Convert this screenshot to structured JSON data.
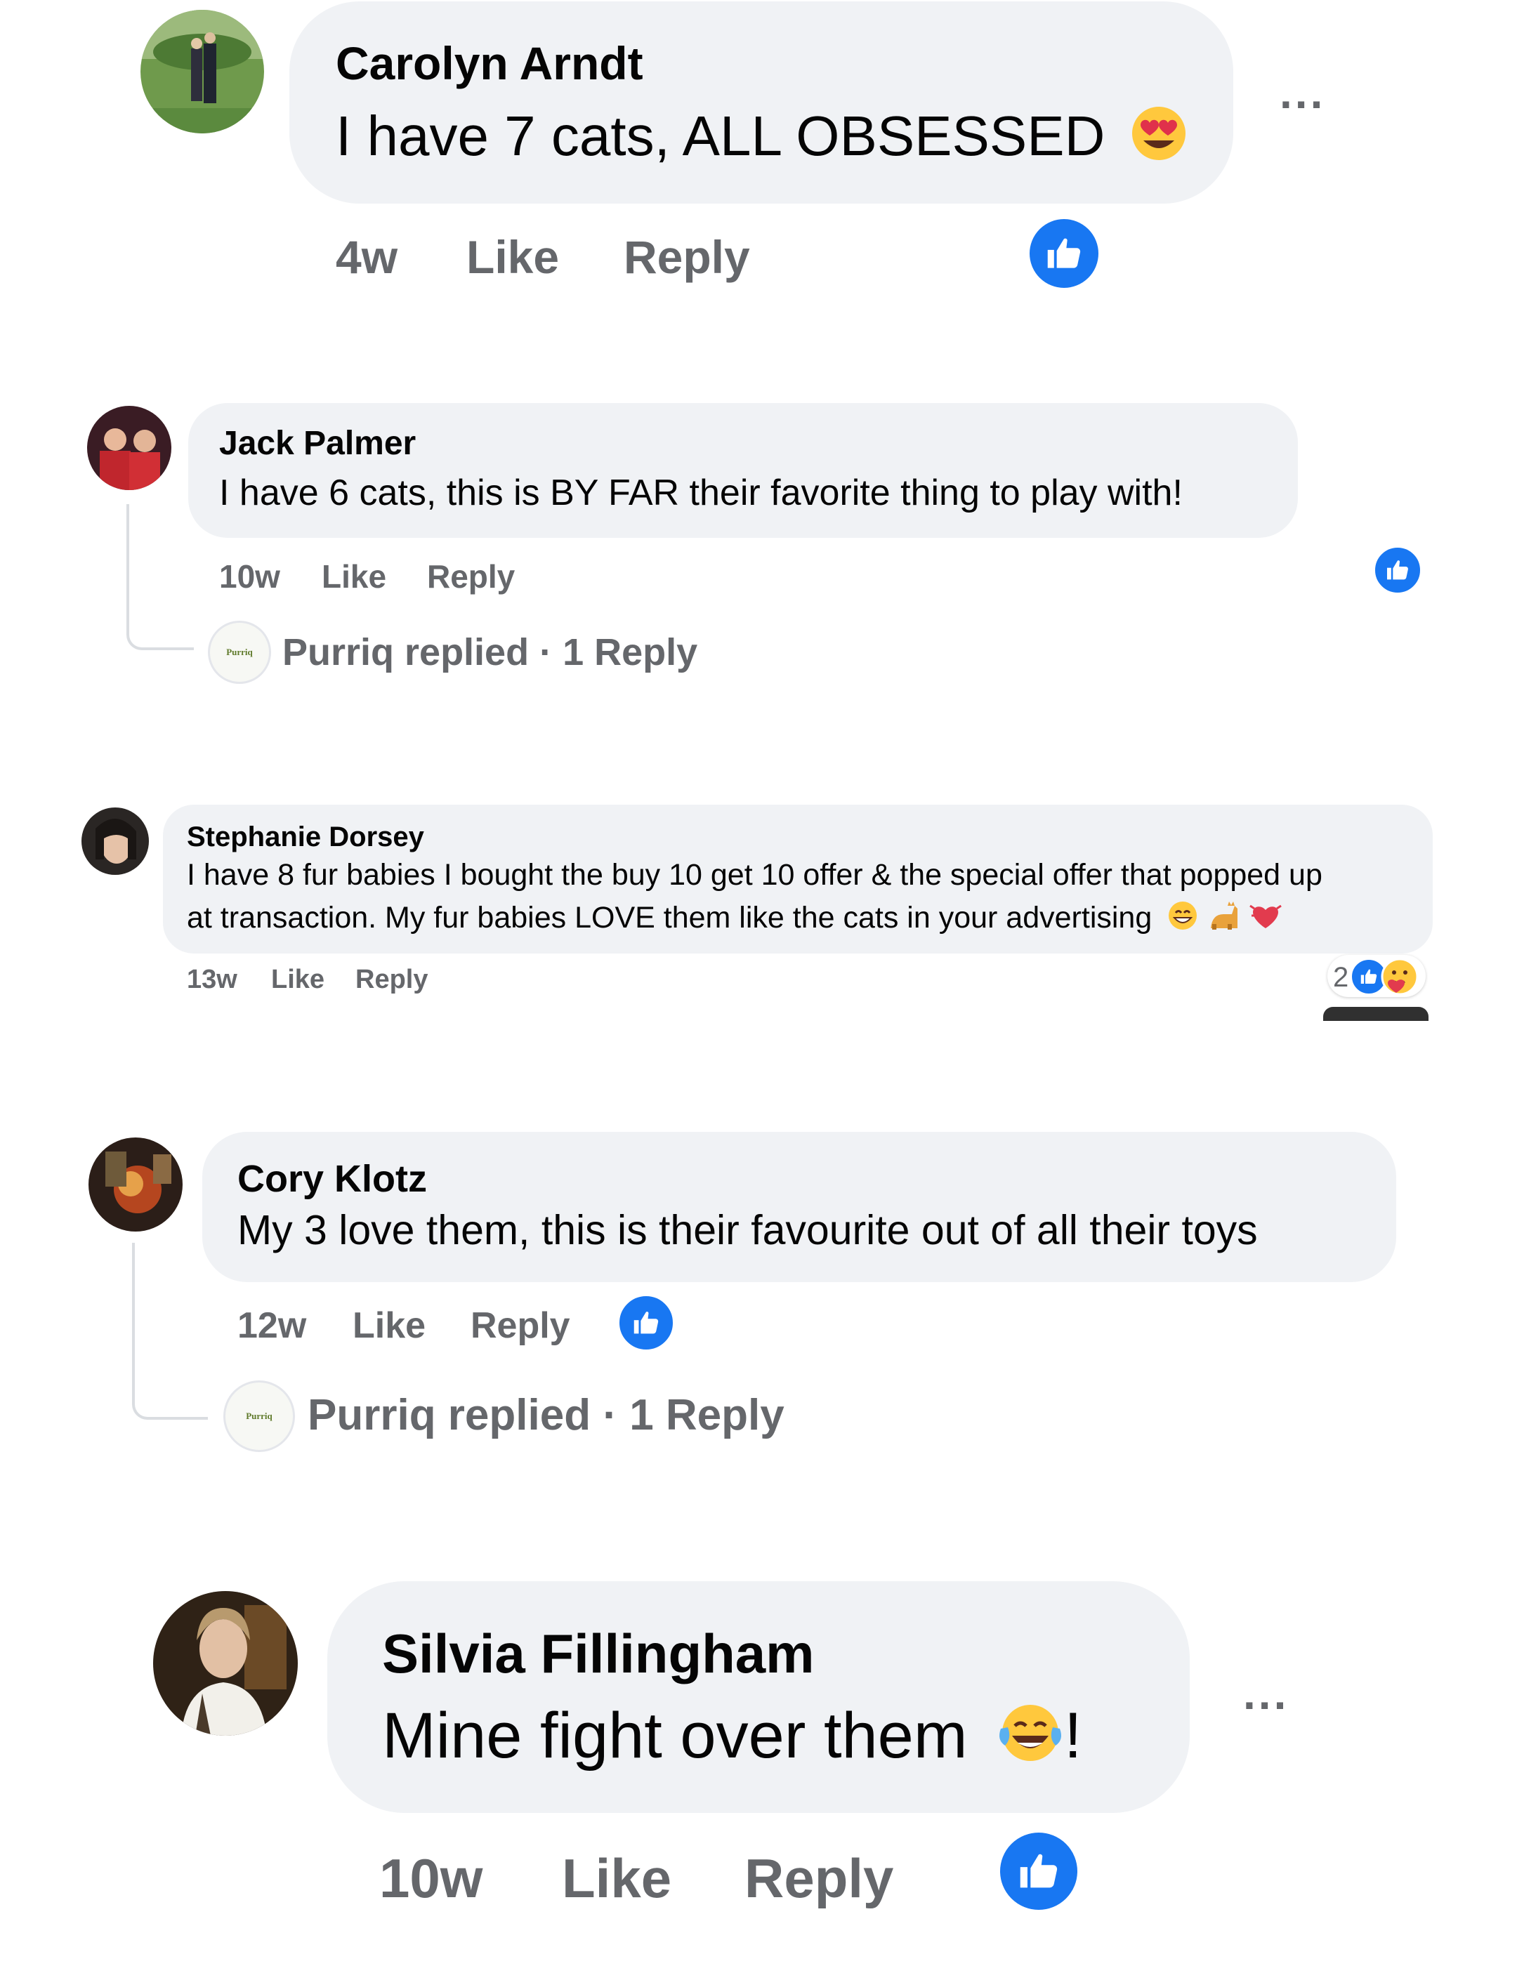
{
  "comments": [
    {
      "author": "Carolyn Arndt",
      "text": "I have 7 cats, ALL OBSESSED",
      "age": "4w",
      "like_label": "Like",
      "reply_label": "Reply",
      "menu": "..."
    },
    {
      "author": "Jack Palmer",
      "text": "I have 6 cats, this is BY FAR their favorite thing to play with!",
      "age": "10w",
      "like_label": "Like",
      "reply_label": "Reply",
      "replied_text": "Purriq replied · 1 Reply",
      "brand": "Purriq"
    },
    {
      "author": "Stephanie Dorsey",
      "text_line1": "I have 8 fur babies I bought the buy 10 get 10 offer & the special offer that popped up",
      "text_line2": "at transaction. My fur babies LOVE them like the cats in your advertising",
      "age": "13w",
      "like_label": "Like",
      "reply_label": "Reply",
      "reaction_count": "2"
    },
    {
      "author": "Cory Klotz",
      "text": "My 3 love them, this is their favourite out of all their toys",
      "age": "12w",
      "like_label": "Like",
      "reply_label": "Reply",
      "replied_text": "Purriq replied · 1 Reply",
      "brand": "Purriq"
    },
    {
      "author": "Silvia Fillingham",
      "text": "Mine fight over them",
      "text_suffix": "!",
      "age": "10w",
      "like_label": "Like",
      "reply_label": "Reply",
      "menu": "..."
    }
  ],
  "colors": {
    "bubble": "#f0f2f5",
    "meta": "#65676b",
    "like_blue": "#1877f2"
  },
  "icons": [
    "like-icon",
    "heart-eyes-emoji",
    "grin-emoji",
    "cat-emoji",
    "heart-emoji",
    "laugh-tears-emoji",
    "care-reaction-icon",
    "more-options-icon"
  ]
}
